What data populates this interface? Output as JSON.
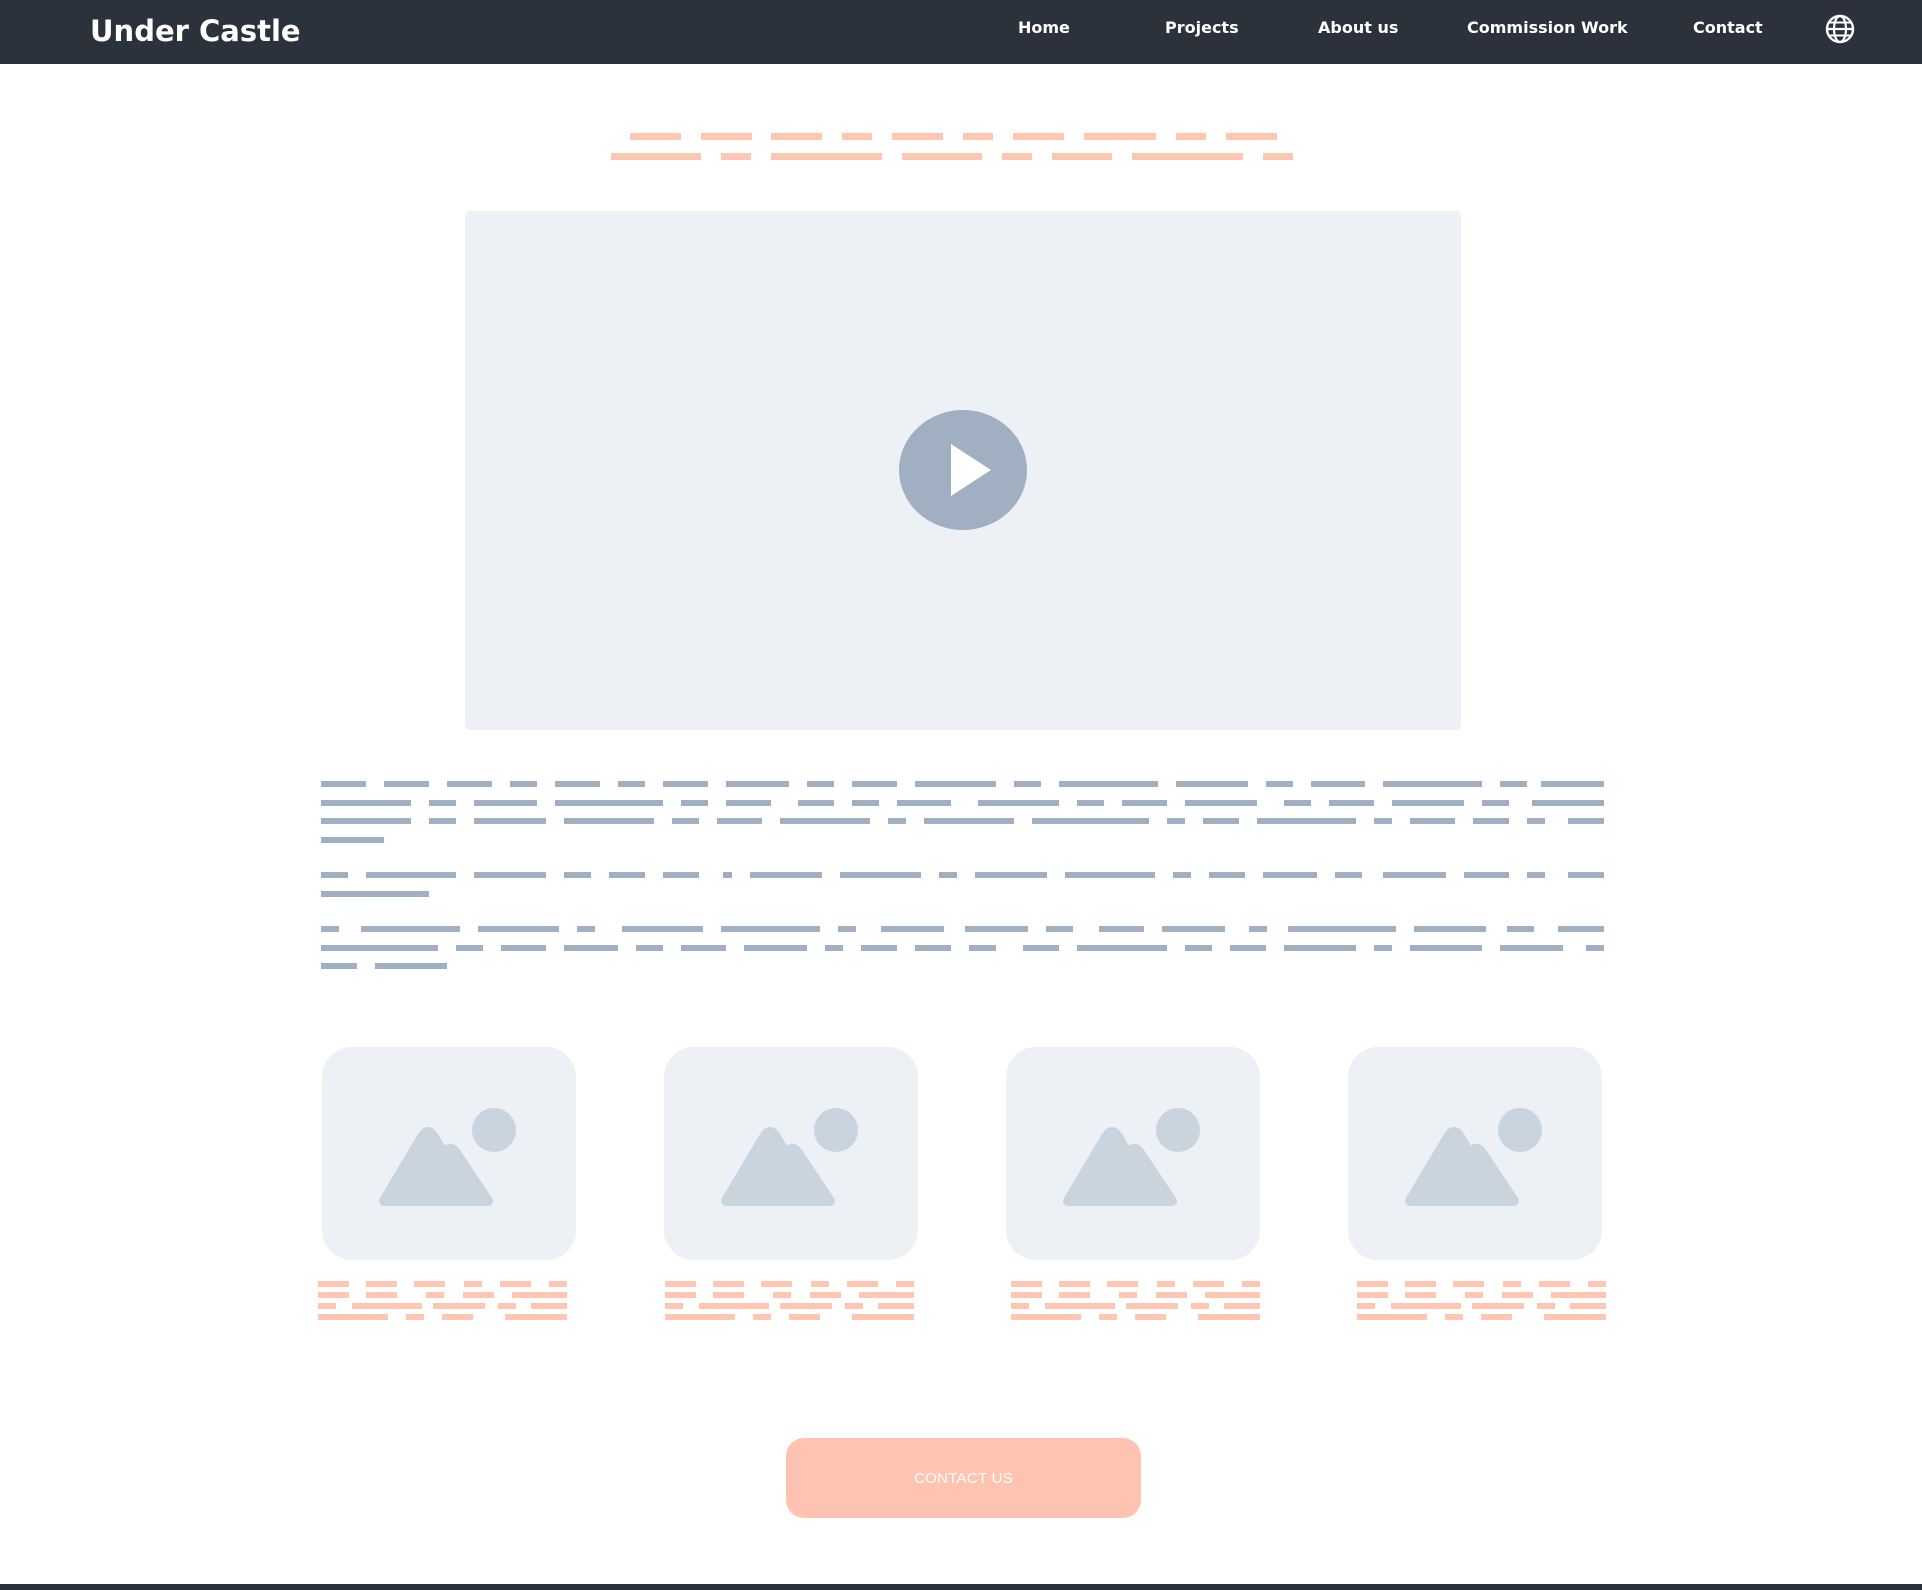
{
  "header": {
    "brand": "Under Castle",
    "nav": [
      {
        "label": "Home"
      },
      {
        "label": "Projects"
      },
      {
        "label": "About us"
      },
      {
        "label": "Commission Work"
      },
      {
        "label": "Contact"
      }
    ],
    "language_icon": "globe-icon"
  },
  "hero": {
    "video_icon": "play-icon"
  },
  "gallery": {
    "image_icon": "image-placeholder-icon",
    "count": 4
  },
  "cta": {
    "label": "CONTACT US"
  },
  "colors": {
    "nav_background": "#2b323c",
    "accent_salmon": "#ffc6b1",
    "placeholder_text": "#a0afc2",
    "placeholder_bg": "#edf0f4",
    "placeholder_icon": "#cad4df",
    "cta_background": "#fec4b1"
  }
}
